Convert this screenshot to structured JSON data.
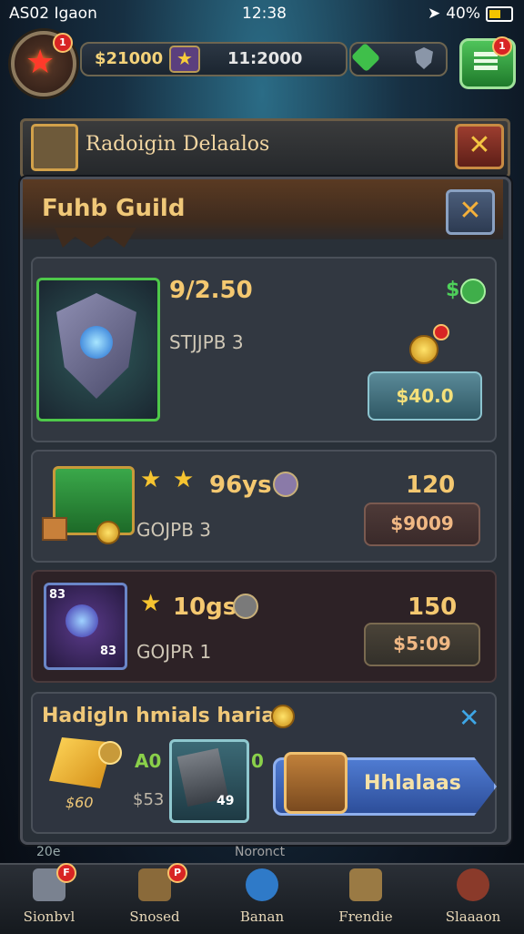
{
  "status_bar": {
    "carrier": "AS02 Igaon",
    "time": "12:38",
    "battery": "40%"
  },
  "hud": {
    "currency": "$21000",
    "counter": "11:2000",
    "badge_count": "1"
  },
  "banner": {
    "title": "Radoigin Delaalos",
    "close_label": "✕"
  },
  "panel": {
    "title": "Fuhb Guild",
    "close_label": "✕"
  },
  "offers": [
    {
      "name": "shield-item",
      "value": "9/2.50",
      "sub": "STJJPB 3",
      "price": "$40.0",
      "side_label": "$"
    },
    {
      "name": "chest-item",
      "value": "96ys",
      "sub": "GOJPB 3",
      "amount": "120",
      "price": "$9009"
    },
    {
      "name": "weapon-item",
      "value": "10gs",
      "sub": "GOJPR 1",
      "amount": "150",
      "price": "$5:09",
      "frame_label_top": "83",
      "frame_label_bottom": "83"
    }
  ],
  "bundle": {
    "title": "Hadigln hmials harian",
    "gold_label": "$60",
    "left_value": "A0",
    "left_sub": "$53",
    "card_label": "49",
    "right_value": "0",
    "action_label": "Hhlalaas"
  },
  "behind_labels": {
    "left": "20e",
    "center": "Noronct"
  },
  "bottom_nav": [
    {
      "label": "Sionbvl",
      "color": "#7a8290"
    },
    {
      "label": "Snosed",
      "color": "#8a6a3a"
    },
    {
      "label": "Banan",
      "color": "#2f7ac8"
    },
    {
      "label": "Frendie",
      "color": "#9a7a44"
    },
    {
      "label": "Slaaaon",
      "color": "#8a3a2a"
    }
  ]
}
